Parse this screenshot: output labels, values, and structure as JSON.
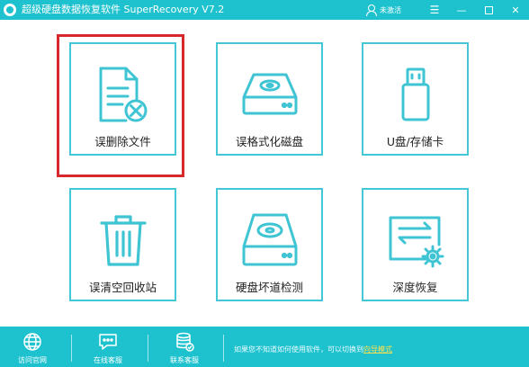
{
  "window": {
    "title": "超级硬盘数据恢复软件 SuperRecovery V7.2",
    "user_label": "未激活",
    "menu_glyph": "☰",
    "minimize_glyph": "—",
    "close_glyph": "✕"
  },
  "tiles": [
    {
      "label": "误删除文件",
      "icon": "deleted-file-icon",
      "selected": true
    },
    {
      "label": "误格式化磁盘",
      "icon": "hard-disk-icon",
      "selected": false
    },
    {
      "label": "U盘/存储卡",
      "icon": "usb-drive-icon",
      "selected": false
    },
    {
      "label": "误清空回收站",
      "icon": "recycle-bin-icon",
      "selected": false
    },
    {
      "label": "硬盘坏道检测",
      "icon": "disk-scan-icon",
      "selected": false
    },
    {
      "label": "深度恢复",
      "icon": "deep-recovery-icon",
      "selected": false
    }
  ],
  "bottom": {
    "items": [
      {
        "label": "访问官网",
        "icon": "globe-icon"
      },
      {
        "label": "在线客服",
        "icon": "chat-icon"
      },
      {
        "label": "联系客服",
        "icon": "database-service-icon"
      }
    ],
    "notice": "如果您不知道如何使用软件，可以切换到",
    "notice_link": "向导模式"
  },
  "colors": {
    "accent": "#1ec2cf",
    "tile_border": "#44c7d6",
    "selection": "#d8282c",
    "link": "#ffe14d"
  }
}
